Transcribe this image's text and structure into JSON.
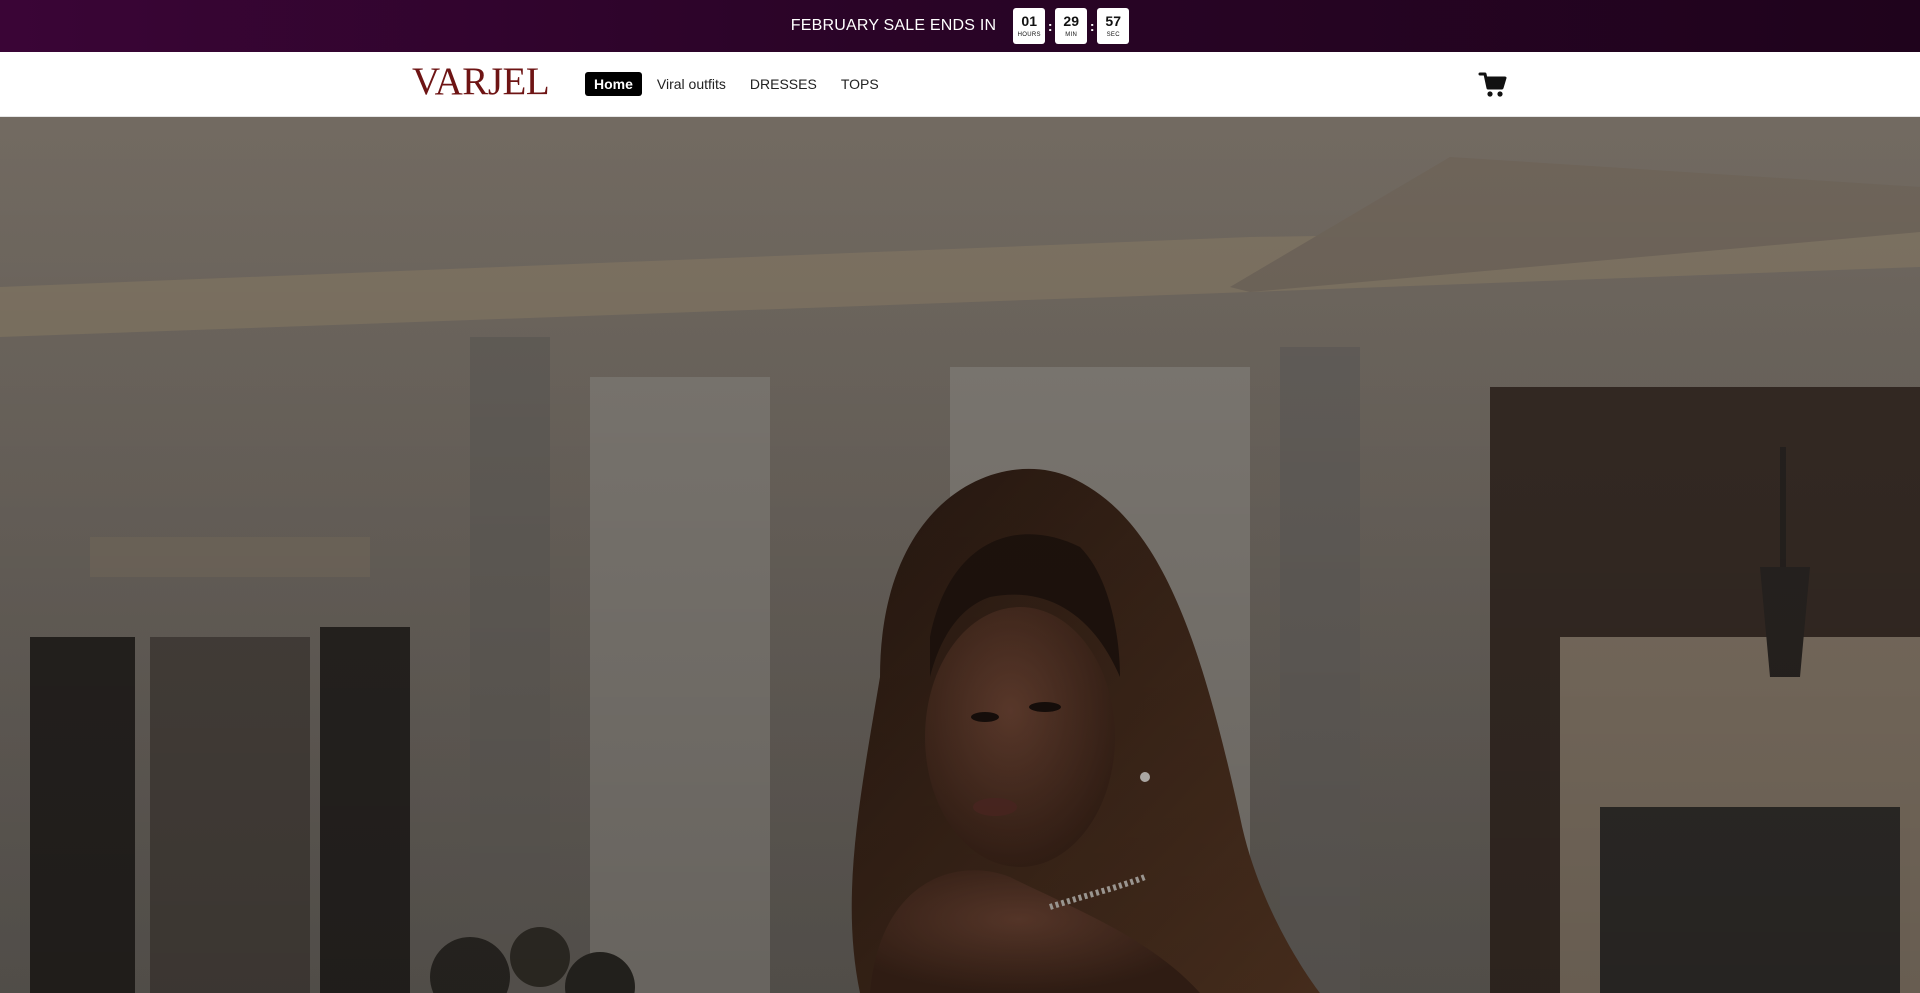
{
  "announcement": {
    "text": "FEBRUARY SALE ENDS IN",
    "countdown": {
      "hours": "01",
      "hours_label": "HOURS",
      "minutes": "29",
      "minutes_label": "MIN",
      "seconds": "57",
      "seconds_label": "SEC",
      "separator": ":"
    }
  },
  "header": {
    "logo": "VARJEL",
    "nav": [
      {
        "label": "Home",
        "active": true
      },
      {
        "label": "Viral outfits"
      },
      {
        "label": "DRESSES"
      },
      {
        "label": "TOPS"
      }
    ],
    "cart_icon": "cart-icon"
  },
  "hero": {
    "image": "hero-photo"
  },
  "colors": {
    "announcement_bg": "#2a0427",
    "logo": "#6e1414",
    "active_nav_bg": "#000000"
  }
}
